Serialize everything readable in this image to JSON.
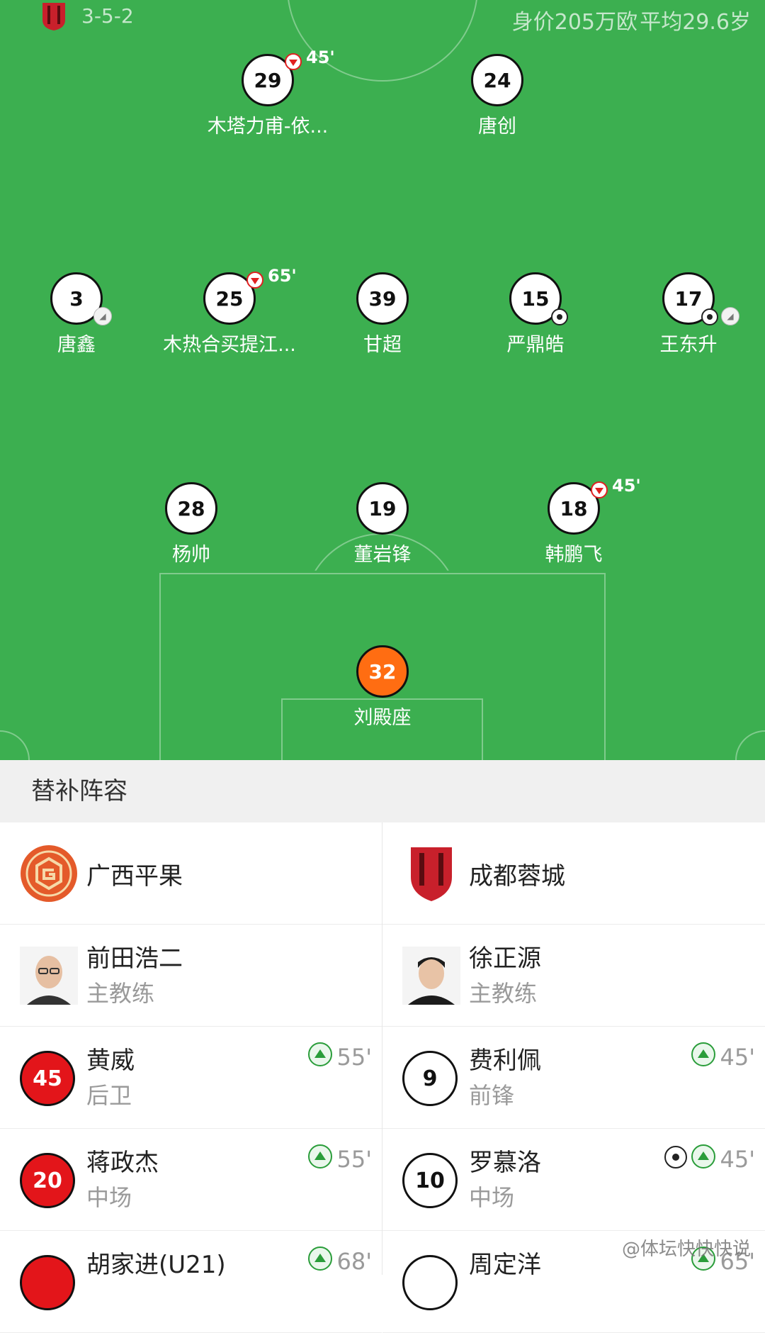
{
  "pitch": {
    "formation": "3-5-2",
    "value": "身价205万欧",
    "avg_age": "平均29.6岁",
    "team_color": "#c8202b",
    "players": [
      {
        "num": "29",
        "name": "木塔力甫-依...",
        "sub_out": "45'"
      },
      {
        "num": "24",
        "name": "唐创"
      },
      {
        "num": "3",
        "name": "唐鑫",
        "badges": [
          "boot"
        ]
      },
      {
        "num": "25",
        "name": "木热合买提江...",
        "sub_out": "65'"
      },
      {
        "num": "39",
        "name": "甘超"
      },
      {
        "num": "15",
        "name": "严鼎皓",
        "badges": [
          "goal"
        ]
      },
      {
        "num": "17",
        "name": "王东升",
        "badges": [
          "goal",
          "boot"
        ]
      },
      {
        "num": "28",
        "name": "杨帅"
      },
      {
        "num": "19",
        "name": "董岩锋"
      },
      {
        "num": "18",
        "name": "韩鹏飞",
        "sub_out": "45'"
      },
      {
        "num": "32",
        "name": "刘殿座",
        "goalkeeper": true
      }
    ]
  },
  "subs": {
    "header": "替补阵容",
    "left": {
      "team": "广西平果",
      "coach": {
        "name": "前田浩二",
        "role": "主教练"
      },
      "players": [
        {
          "num": "45",
          "name": "黄威",
          "role": "后卫",
          "minute": "55'",
          "style": "red"
        },
        {
          "num": "20",
          "name": "蒋政杰",
          "role": "中场",
          "minute": "55'",
          "style": "red"
        },
        {
          "num": "",
          "name": "胡家进(U21)",
          "role": "",
          "minute": "68'",
          "style": "red"
        }
      ]
    },
    "right": {
      "team": "成都蓉城",
      "coach": {
        "name": "徐正源",
        "role": "主教练"
      },
      "players": [
        {
          "num": "9",
          "name": "费利佩",
          "role": "前锋",
          "minute": "45'",
          "style": "white"
        },
        {
          "num": "10",
          "name": "罗慕洛",
          "role": "中场",
          "minute": "45'",
          "style": "white",
          "goal": true
        },
        {
          "num": "",
          "name": "周定洋",
          "role": "",
          "minute": "65'",
          "style": "white"
        }
      ]
    }
  },
  "watermark": "@体坛快快快说",
  "colors": {
    "pitch": "#3caf50",
    "goalkeeper": "#ff6d12",
    "sub_in": "#2a9d3a",
    "sub_out": "#e02020",
    "red_number": "#e3151a"
  },
  "icons": [
    "chengdu-logo-icon",
    "guangxi-logo-icon",
    "sub-out-icon",
    "sub-in-icon",
    "goal-ball-icon",
    "boot-icon",
    "coach-avatar-icon"
  ]
}
